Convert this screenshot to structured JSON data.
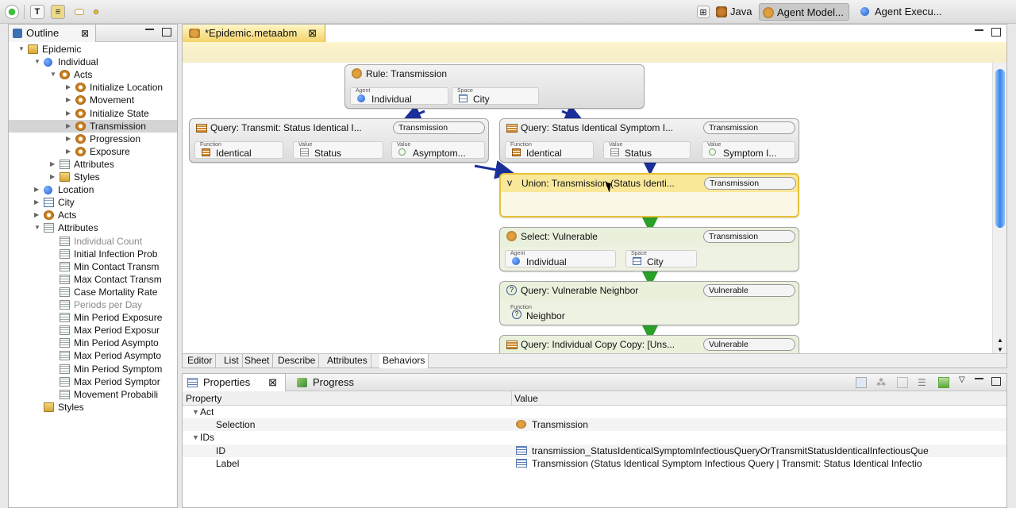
{
  "perspectives": [
    {
      "label": "Java",
      "icon": "java-perspective-icon",
      "active": false
    },
    {
      "label": "Agent Model...",
      "icon": "agent-model-perspective-icon",
      "active": true
    },
    {
      "label": "Agent Execu...",
      "icon": "agent-execution-perspective-icon",
      "active": false
    }
  ],
  "outline": {
    "tab_label": "Outline",
    "tree": [
      {
        "label": "Epidemic",
        "depth": 0,
        "icon": "model-icon",
        "expanded": true
      },
      {
        "label": "Individual",
        "depth": 1,
        "icon": "agent-icon",
        "expanded": true
      },
      {
        "label": "Acts",
        "depth": 2,
        "icon": "acts-icon",
        "expanded": true
      },
      {
        "label": "Initialize Location",
        "depth": 3,
        "icon": "act-icon",
        "expanded": false
      },
      {
        "label": "Movement",
        "depth": 3,
        "icon": "act-icon",
        "expanded": false
      },
      {
        "label": "Initialize State",
        "depth": 3,
        "icon": "act-icon",
        "expanded": false
      },
      {
        "label": "Transmission",
        "depth": 3,
        "icon": "act-icon",
        "expanded": false,
        "selected": true
      },
      {
        "label": "Progression",
        "depth": 3,
        "icon": "act-icon",
        "expanded": false
      },
      {
        "label": "Exposure",
        "depth": 3,
        "icon": "act-icon",
        "expanded": false
      },
      {
        "label": "Attributes",
        "depth": 2,
        "icon": "attributes-icon",
        "expanded": false
      },
      {
        "label": "Styles",
        "depth": 2,
        "icon": "styles-icon",
        "expanded": false
      },
      {
        "label": "Location",
        "depth": 1,
        "icon": "agent-icon",
        "expanded": false
      },
      {
        "label": "City",
        "depth": 1,
        "icon": "space-icon",
        "expanded": false
      },
      {
        "label": "Acts",
        "depth": 1,
        "icon": "acts-icon",
        "expanded": false
      },
      {
        "label": "Attributes",
        "depth": 1,
        "icon": "attributes-icon",
        "expanded": true
      },
      {
        "label": "Individual Count",
        "depth": 2,
        "icon": "attribute-icon",
        "dim": true
      },
      {
        "label": "Initial Infection Prob",
        "depth": 2,
        "icon": "attribute-icon"
      },
      {
        "label": "Min Contact Transm",
        "depth": 2,
        "icon": "attribute-icon"
      },
      {
        "label": "Max Contact Transm",
        "depth": 2,
        "icon": "attribute-icon"
      },
      {
        "label": "Case Mortality Rate",
        "depth": 2,
        "icon": "attribute-icon"
      },
      {
        "label": "Periods per Day",
        "depth": 2,
        "icon": "attribute-icon",
        "dim": true
      },
      {
        "label": "Min Period Exposure",
        "depth": 2,
        "icon": "attribute-icon"
      },
      {
        "label": "Max Period Exposur",
        "depth": 2,
        "icon": "attribute-icon"
      },
      {
        "label": "Min Period Asympto",
        "depth": 2,
        "icon": "attribute-icon"
      },
      {
        "label": "Max Period Asympto",
        "depth": 2,
        "icon": "attribute-icon"
      },
      {
        "label": "Min Period Symptom",
        "depth": 2,
        "icon": "attribute-icon"
      },
      {
        "label": "Max Period Symptor",
        "depth": 2,
        "icon": "attribute-icon"
      },
      {
        "label": "Movement Probabili",
        "depth": 2,
        "icon": "attribute-icon"
      },
      {
        "label": "Styles",
        "depth": 1,
        "icon": "styles-icon"
      }
    ]
  },
  "editor": {
    "tab_label": "*Epidemic.metaabm",
    "bottom_tabs": [
      "Editor",
      "List",
      "Sheet",
      "Describe",
      "Attributes",
      "Behaviors"
    ],
    "active_bottom_tab": "Behaviors",
    "nodes": {
      "rule": {
        "title": "Rule: Transmission",
        "slots": [
          {
            "cap": "Agent",
            "val": "Individual"
          },
          {
            "cap": "Space",
            "val": "City"
          }
        ]
      },
      "query_transmit": {
        "title": "Query: Transmit: Status Identical I...",
        "badge": "Transmission",
        "slots": [
          {
            "cap": "Function",
            "val": "Identical"
          },
          {
            "cap": "Value",
            "val": "Status"
          },
          {
            "cap": "Value",
            "val": "Asymptom..."
          }
        ]
      },
      "query_symptom": {
        "title": "Query: Status Identical Symptom I...",
        "badge": "Transmission",
        "slots": [
          {
            "cap": "Function",
            "val": "Identical"
          },
          {
            "cap": "Value",
            "val": "Status"
          },
          {
            "cap": "Value",
            "val": "Symptom I..."
          }
        ]
      },
      "union": {
        "title": "Union: Transmission (Status Identi...",
        "badge": "Transmission"
      },
      "select": {
        "title": "Select: Vulnerable",
        "badge": "Transmission",
        "slots": [
          {
            "cap": "Agent",
            "val": "Individual"
          },
          {
            "cap": "Space",
            "val": "City"
          }
        ]
      },
      "query_neighbor": {
        "title": "Query: Vulnerable Neighbor",
        "badge": "Vulnerable",
        "slots": [
          {
            "cap": "Function",
            "val": "Neighbor"
          }
        ]
      },
      "query_copy": {
        "title": "Query: Individual Copy Copy: [Uns...",
        "badge": "Vulnerable"
      }
    }
  },
  "properties": {
    "tabs": [
      "Properties",
      "Progress"
    ],
    "columns": {
      "property": "Property",
      "value": "Value"
    },
    "rows": [
      {
        "kind": "group",
        "label": "Act"
      },
      {
        "kind": "item",
        "label": "Selection",
        "value": "Transmission",
        "icon": "act-icon"
      },
      {
        "kind": "group",
        "label": "IDs"
      },
      {
        "kind": "item",
        "label": "ID",
        "value": "transmission_StatusIdenticalSymptomInfectiousQueryOrTransmitStatusIdenticalInfectiousQue",
        "icon": "text-field-icon"
      },
      {
        "kind": "item",
        "label": "Label",
        "value": "Transmission (Status Identical Symptom Infectious Query | Transmit: Status Identical Infectio",
        "icon": "text-field-icon"
      }
    ]
  },
  "colors": {
    "selection_yellow": "#f4d468",
    "edge_blue": "#1a2f9a",
    "edge_green": "#2aa02a"
  }
}
